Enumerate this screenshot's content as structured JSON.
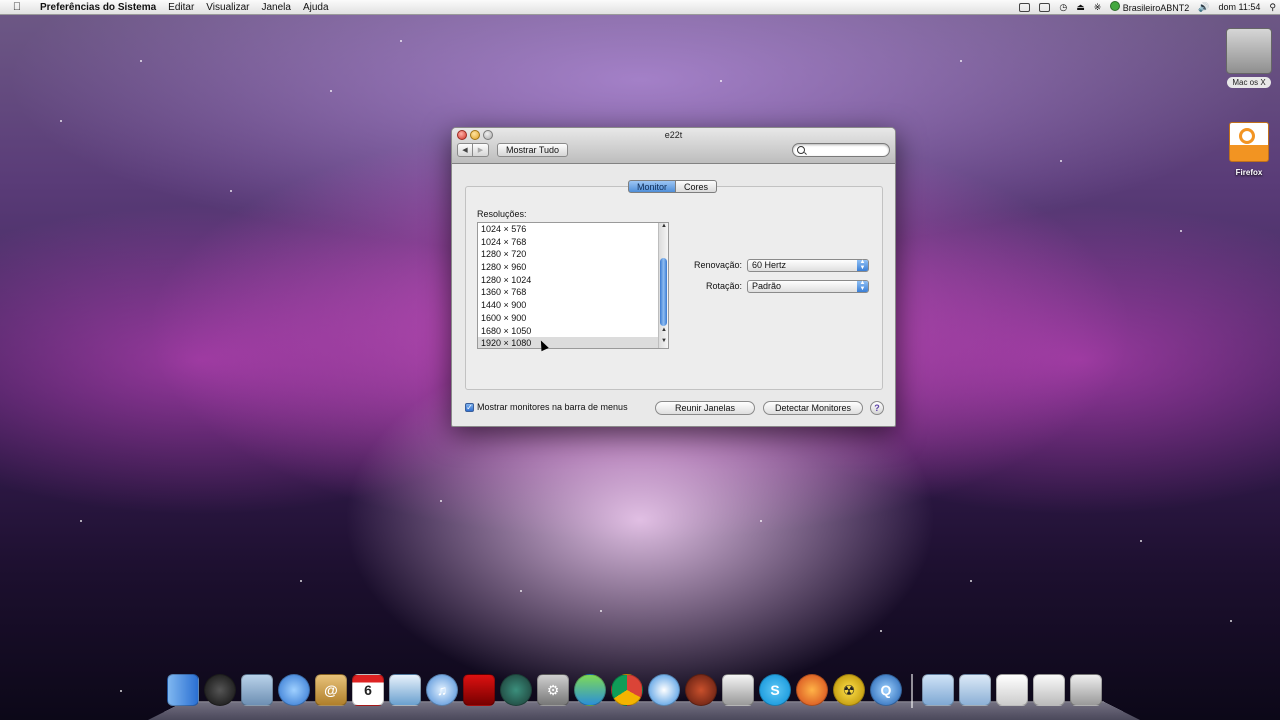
{
  "menubar": {
    "app_name": "Preferências do Sistema",
    "menus": [
      "Editar",
      "Visualizar",
      "Janela",
      "Ajuda"
    ],
    "keyboard_layout": "BrasileiroABNT2",
    "clock": "dom 11:54"
  },
  "desktop_icons": [
    {
      "label": "Mac os X",
      "icon": "hard-drive-icon"
    },
    {
      "label": "Firefox",
      "icon": "firefox-download-icon"
    }
  ],
  "window": {
    "title": "e22t",
    "show_all_label": "Mostrar Tudo",
    "search_placeholder": "",
    "tabs": [
      {
        "label": "Monitor",
        "selected": true
      },
      {
        "label": "Cores",
        "selected": false
      }
    ],
    "resolutions_label": "Resoluções:",
    "resolutions": [
      "1024 × 576",
      "1024 × 768",
      "1280 × 720",
      "1280 × 960",
      "1280 × 1024",
      "1360 × 768",
      "1440 × 900",
      "1600 × 900",
      "1680 × 1050",
      "1920 × 1080"
    ],
    "selected_resolution": "1920 × 1080",
    "refresh": {
      "label": "Renovação:",
      "value": "60 Hertz"
    },
    "rotation": {
      "label": "Rotação:",
      "value": "Padrão"
    },
    "mirror_checkbox": {
      "label": "Mostrar monitores na barra de menus",
      "checked": true
    },
    "gather_button": "Reunir Janelas",
    "detect_button": "Detectar Monitores",
    "help_label": "?",
    "calendar_day": "6"
  },
  "dock": {
    "apps": [
      "finder-icon",
      "dashboard-icon",
      "mail-icon",
      "ichat-icon",
      "address-book-icon",
      "ical-icon",
      "iphoto-icon",
      "itunes-icon",
      "photo-booth-icon",
      "time-machine-icon",
      "system-preferences-icon",
      "messenger-icon",
      "chrome-icon",
      "safari-icon",
      "game-icon",
      "imovie-icon",
      "skype-icon",
      "firefox-icon",
      "radiation-icon",
      "quicktime-icon"
    ],
    "stacks": [
      "applications-stack-icon",
      "documents-stack-icon",
      "downloads-stack-icon",
      "file-stack-icon",
      "trash-icon"
    ]
  }
}
